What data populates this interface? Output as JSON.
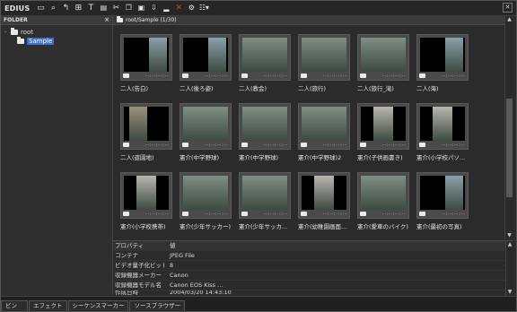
{
  "app": {
    "name": "EDIUS"
  },
  "toolbar": {
    "buttons": [
      "folder-icon",
      "search-icon",
      "up-icon",
      "import-icon",
      "title-icon",
      "color-bar-icon",
      "cut-icon",
      "copy-icon",
      "paste-icon",
      "add-to-timeline-icon",
      "add-icon",
      "delete-icon",
      "properties-icon",
      "view-icon"
    ]
  },
  "folder_panel": {
    "title": "FOLDER",
    "close": "×",
    "tree": [
      {
        "expander": "-",
        "label": "root"
      },
      {
        "expander": "",
        "label": "Sample"
      }
    ]
  },
  "bin": {
    "path": "root/Sample (1/30)",
    "clips": [
      {
        "label": "二人(告白)",
        "timecode": "--:--:--:--",
        "picture": "portrait-right"
      },
      {
        "label": "二人(後ろ姿)",
        "timecode": "--:--:--:--",
        "picture": "portrait-right"
      },
      {
        "label": "二人(教会)",
        "timecode": "--:--:--:--",
        "picture": "landscape"
      },
      {
        "label": "二人(旅行)",
        "timecode": "--:--:--:--",
        "picture": "landscape"
      },
      {
        "label": "二人(旅行_滝)",
        "timecode": "--:--:--:--",
        "picture": "landscape"
      },
      {
        "label": "二人(海)",
        "timecode": "--:--:--:--",
        "picture": "portrait-right"
      },
      {
        "label": "二人(遊園地)",
        "timecode": "--:--:--:--",
        "picture": "portrait-left"
      },
      {
        "label": "憲介(中学野球)",
        "timecode": "--:--:--:--",
        "picture": "landscape"
      },
      {
        "label": "憲介(中学野球)",
        "timecode": "--:--:--:--",
        "picture": "landscape"
      },
      {
        "label": "憲介(中学野球)2",
        "timecode": "--:--:--:--",
        "picture": "landscape"
      },
      {
        "label": "憲介(子供画書き)",
        "timecode": "--:--:--:--",
        "picture": "portrait-center"
      },
      {
        "label": "憲介(小学校パソ...",
        "timecode": "--:--:--:--",
        "picture": "portrait-center"
      },
      {
        "label": "憲介(小学校携帯)",
        "timecode": "--:--:--:--",
        "picture": "portrait-center"
      },
      {
        "label": "憲介(少年サッカー)",
        "timecode": "--:--:--:--",
        "picture": "landscape"
      },
      {
        "label": "憲介(少年サッカ...",
        "timecode": "--:--:--:--",
        "picture": "landscape"
      },
      {
        "label": "憲介(幼稚園画面...",
        "timecode": "--:--:--:--",
        "picture": "portrait-center"
      },
      {
        "label": "憲介(愛車のバイク)",
        "timecode": "--:--:--:--",
        "picture": "landscape"
      },
      {
        "label": "憲介(最初の写真)",
        "timecode": "--:--:--:--",
        "picture": "portrait-right"
      }
    ]
  },
  "properties": {
    "header": {
      "key": "プロパティ",
      "value": "値"
    },
    "rows": [
      {
        "key": "コンテナ",
        "value": "JPEG File"
      },
      {
        "key": "ビデオ量子化ビット...",
        "value": "8"
      },
      {
        "key": "収録機器メーカー",
        "value": "Canon"
      },
      {
        "key": "収録機器モデル名",
        "value": "Canon EOS Kiss ..."
      },
      {
        "key": "作成日時",
        "value": "2004/03/20 14:43:10"
      }
    ]
  },
  "tabs": [
    "ビン",
    "エフェクト",
    "シーケンスマーカー",
    "ソースブラウザー"
  ],
  "colors": {
    "selection": "#3f6fc7",
    "delete": "#e03b2a",
    "panel_bg": "#2b2b2b"
  }
}
